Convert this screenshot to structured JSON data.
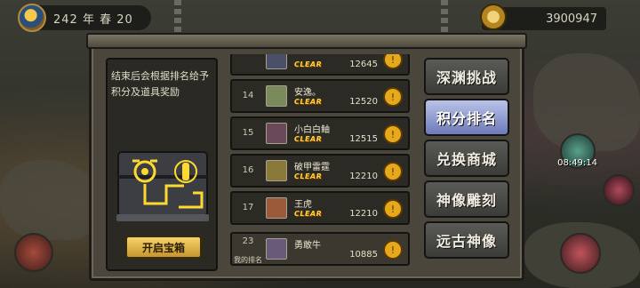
{
  "topbar": {
    "season_text": "242 年 春 20",
    "gold_amount": "3900947"
  },
  "left_pane": {
    "description": "结束后会根据排名给予积分及道具奖励",
    "open_chest_label": "开启宝箱"
  },
  "rankings": [
    {
      "rank": "",
      "name": "",
      "badge": "CLEAR",
      "score": "12645"
    },
    {
      "rank": "14",
      "name": "安逸。",
      "badge": "CLEAR",
      "score": "12520"
    },
    {
      "rank": "15",
      "name": "小白白鲉",
      "badge": "CLEAR",
      "score": "12515"
    },
    {
      "rank": "16",
      "name": "破甲雷霆",
      "badge": "CLEAR",
      "score": "12210"
    },
    {
      "rank": "17",
      "name": "王虎",
      "badge": "CLEAR",
      "score": "12210"
    }
  ],
  "my_rank": {
    "rank": "23",
    "label": "我的排名",
    "name": "勇敢牛",
    "score": "10885"
  },
  "tabs": [
    {
      "label": "深渊挑战",
      "active": false
    },
    {
      "label": "积分排名",
      "active": true
    },
    {
      "label": "兑换商城",
      "active": false
    },
    {
      "label": "神像雕刻",
      "active": false
    },
    {
      "label": "远古神像",
      "active": false
    }
  ],
  "side": {
    "timer": "08:49:14"
  },
  "colors": {
    "accent_gold": "#ffd23a",
    "active_tab": "#8e9bd4",
    "panel": "#4a463c"
  }
}
